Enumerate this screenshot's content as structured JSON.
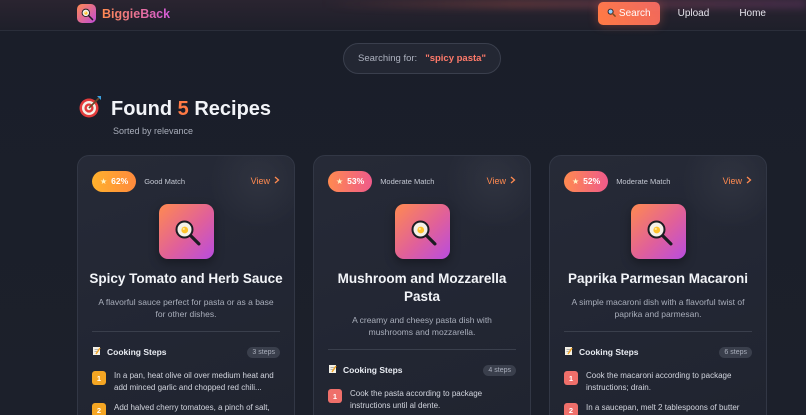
{
  "nav": {
    "brand": "BiggieBack",
    "search_label": "Search",
    "upload_label": "Upload",
    "home_label": "Home"
  },
  "search": {
    "label": "Searching for:",
    "query": "\"spicy pasta\""
  },
  "results": {
    "found_prefix": "Found",
    "count": "5",
    "found_suffix": "Recipes",
    "sorted_by": "Sorted by relevance"
  },
  "card_labels": {
    "view": "View",
    "cooking_steps": "Cooking Steps"
  },
  "recipes": [
    {
      "match": "62%",
      "match_label": "Good Match",
      "title": "Spicy Tomato and Herb Sauce",
      "description": "A flavorful sauce perfect for pasta or as a base for other dishes.",
      "steps_count": "3 steps",
      "steps": [
        {
          "num": "1",
          "text": "In a pan, heat olive oil over medium heat and add minced garlic and chopped red chili..."
        },
        {
          "num": "2",
          "text": "Add halved cherry tomatoes, a pinch of salt,"
        }
      ]
    },
    {
      "match": "53%",
      "match_label": "Moderate Match",
      "title": "Mushroom and Mozzarella Pasta",
      "description": "A creamy and cheesy pasta dish with mushrooms and mozzarella.",
      "steps_count": "4 steps",
      "steps": [
        {
          "num": "1",
          "text": "Cook the pasta according to package instructions until al dente."
        }
      ]
    },
    {
      "match": "52%",
      "match_label": "Moderate Match",
      "title": "Paprika Parmesan Macaroni",
      "description": "A simple macaroni dish with a flavorful twist of paprika and parmesan.",
      "steps_count": "6 steps",
      "steps": [
        {
          "num": "1",
          "text": "Cook the macaroni according to package instructions; drain."
        },
        {
          "num": "2",
          "text": "In a saucepan, melt 2 tablespoons of butter"
        }
      ]
    }
  ],
  "colors": {
    "accent": "#ff7a45",
    "background": "#1b1f2a",
    "card": "#242835",
    "good_match": "#ffb12c",
    "moderate_match": "#ef5a8a"
  },
  "icons": {
    "brand": "frying-pan-icon",
    "nav_search": "magnifier-icon",
    "heading": "target-icon",
    "match": "star-icon",
    "view": "chevron-right-icon",
    "recipe": "frying-pan-icon",
    "steps": "memo-icon"
  }
}
